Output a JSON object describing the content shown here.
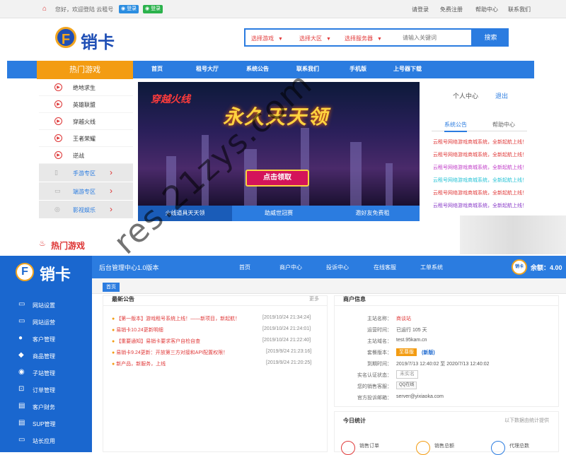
{
  "topbar": {
    "greeting": "您好，欢迎登陆 云租号",
    "qq_login": "登录",
    "wechat_login": "登录",
    "links": [
      "请登录",
      "免费注册",
      "帮助中心",
      "联系我们"
    ]
  },
  "brand": {
    "logo_letter": "F",
    "name": "销卡"
  },
  "search": {
    "dropdowns": [
      "选择游戏",
      "选择大区",
      "选择服务器"
    ],
    "placeholder": "请输入关键词",
    "button": "搜索"
  },
  "nav": {
    "hot_label": "热门游戏",
    "items": [
      "首页",
      "租号大厅",
      "系统公告",
      "联系我们",
      "手机版",
      "上号器下载"
    ]
  },
  "side_menu": {
    "games": [
      "绝地求生",
      "英雄联盟",
      "穿越火线",
      "王者荣耀",
      "逆战"
    ],
    "zones": [
      {
        "icon": "phone-icon",
        "label": "手游专区"
      },
      {
        "icon": "monitor-icon",
        "label": "端游专区"
      },
      {
        "icon": "film-icon",
        "label": "影视娱乐"
      }
    ]
  },
  "banner": {
    "game_name": "穿越火线",
    "headline": "永久天天领",
    "cta": "点击领取",
    "tabs": [
      "火线道具天天领",
      "助威世冠赛",
      "邀好友免费租"
    ]
  },
  "user_panel": {
    "user_center": "个人中心",
    "logout": "退出"
  },
  "news_panel": {
    "tabs": [
      "系统公告",
      "帮助中心"
    ],
    "items": [
      {
        "text": "云租号网络游戏商城系统，全新起航上线！",
        "color": "#e03b3b"
      },
      {
        "text": "云租号网络游戏商城系统，全新起航上线！",
        "color": "#e03b3b"
      },
      {
        "text": "云租号网络游戏商城系统，全新起航上线！",
        "color": "#c03cc8"
      },
      {
        "text": "云租号网络游戏商城系统，全新起航上线！",
        "color": "#27c3d6"
      },
      {
        "text": "云租号网络游戏商城系统，全新起航上线！",
        "color": "#e03b3b"
      },
      {
        "text": "云租号网络游戏商城系统，全新起航上线！",
        "color": "#8a3cc8"
      }
    ]
  },
  "hot_games": {
    "title": "热门游戏"
  },
  "admin": {
    "brand_letter": "F",
    "brand_name": "销卡",
    "title": "后台管理中心1.0版本",
    "nav": [
      "首页",
      "商户中心",
      "投诉中心",
      "在线客服",
      "工单系统"
    ],
    "avatar_text": "销卡",
    "balance": "余额：4.00",
    "breadcrumb": "首页",
    "menu": [
      {
        "icon": "settings-icon",
        "label": "网站设置"
      },
      {
        "icon": "operations-icon",
        "label": "网站运营"
      },
      {
        "icon": "customer-icon",
        "label": "客户管理"
      },
      {
        "icon": "product-icon",
        "label": "商品管理"
      },
      {
        "icon": "substation-icon",
        "label": "子站管理"
      },
      {
        "icon": "cart-icon",
        "label": "订单管理"
      },
      {
        "icon": "finance-icon",
        "label": "客户财务"
      },
      {
        "icon": "sup-icon",
        "label": "SUP管理"
      },
      {
        "icon": "webmaster-icon",
        "label": "站长应用"
      }
    ],
    "notices": {
      "title": "最新公告",
      "more": "更多",
      "items": [
        {
          "text": "【第一版本】游戏租号系统上线！——新项目，新起航！",
          "date": "[2019/10/24 21:34:24]"
        },
        {
          "text": "易销卡10.24更新明细",
          "date": "[2019/10/24 21:24:01]"
        },
        {
          "text": "【重要通知】易销卡要求客户自检自查",
          "date": "[2019/10/24 21:22:40]"
        },
        {
          "text": "易销卡9.24更新：开放第三方对接和API配置权限！",
          "date": "[2019/9/24 21:23:16]"
        },
        {
          "text": "新产品，新服务，上线",
          "date": "[2019/9/24 21:20:25]"
        }
      ]
    },
    "info": {
      "title": "商户信息",
      "rows": [
        {
          "label": "主站名称：",
          "value": "商谈站"
        },
        {
          "label": "运营时间：",
          "value": "已运行 105 天"
        },
        {
          "label": "主站域名：",
          "value": "test.95kam.cn"
        },
        {
          "label": "套餐版本：",
          "value": ""
        },
        {
          "label": "到期时间：",
          "value": "2019/7/13 12:40:02 至 2020/7/13 12:40:02"
        },
        {
          "label": "实名认证状态：",
          "value": ""
        },
        {
          "label": "您的销售客服：",
          "value": ""
        },
        {
          "label": "官方投诉邮箱：",
          "value": "server@yixiaoka.com"
        }
      ],
      "version_badge": "至尊版",
      "version_new": "(新版)",
      "auth_status": "未实名",
      "sales_qq": "QQ在线"
    },
    "stats": {
      "title": "今日统计",
      "note": "以下数据由统计提供",
      "cards": [
        {
          "label": "销售订单",
          "color": "#e03b3b"
        },
        {
          "label": "销售总额",
          "color": "#f39c12"
        },
        {
          "label": "代理总数",
          "color": "#2b7ce0"
        }
      ]
    }
  },
  "watermark": "res.21zys.com"
}
